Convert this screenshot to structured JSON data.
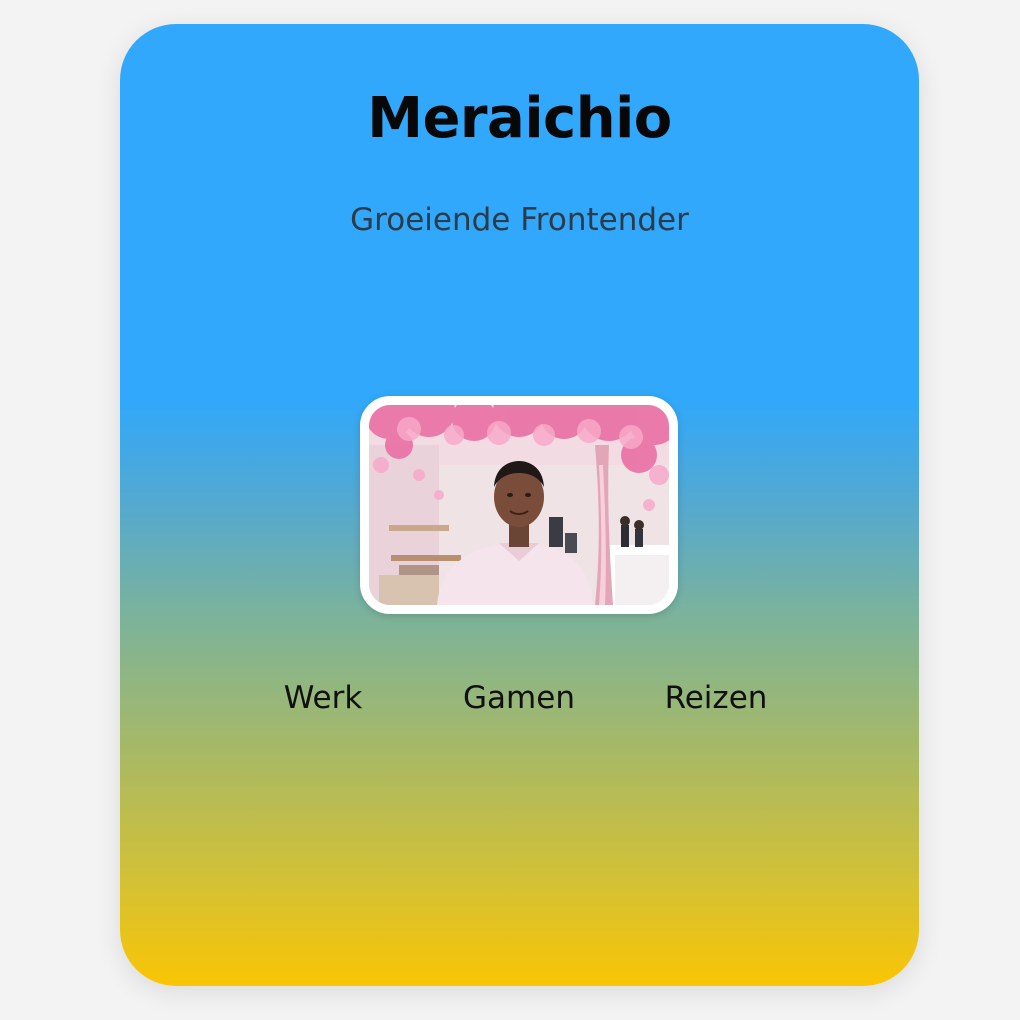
{
  "profile": {
    "name": "Meraichio",
    "subtitle": "Groeiende Frontender"
  },
  "photo": {
    "alt": "Portrait photo of Meraichio"
  },
  "nav": {
    "items": [
      {
        "label": "Werk"
      },
      {
        "label": "Gamen"
      },
      {
        "label": "Reizen"
      }
    ]
  },
  "colors": {
    "page_background": "#f3f3f3",
    "gradient_top": "#31a8fb",
    "gradient_bottom": "#fac504",
    "title_text": "#080808",
    "subtitle_text": "#2d3b48"
  }
}
